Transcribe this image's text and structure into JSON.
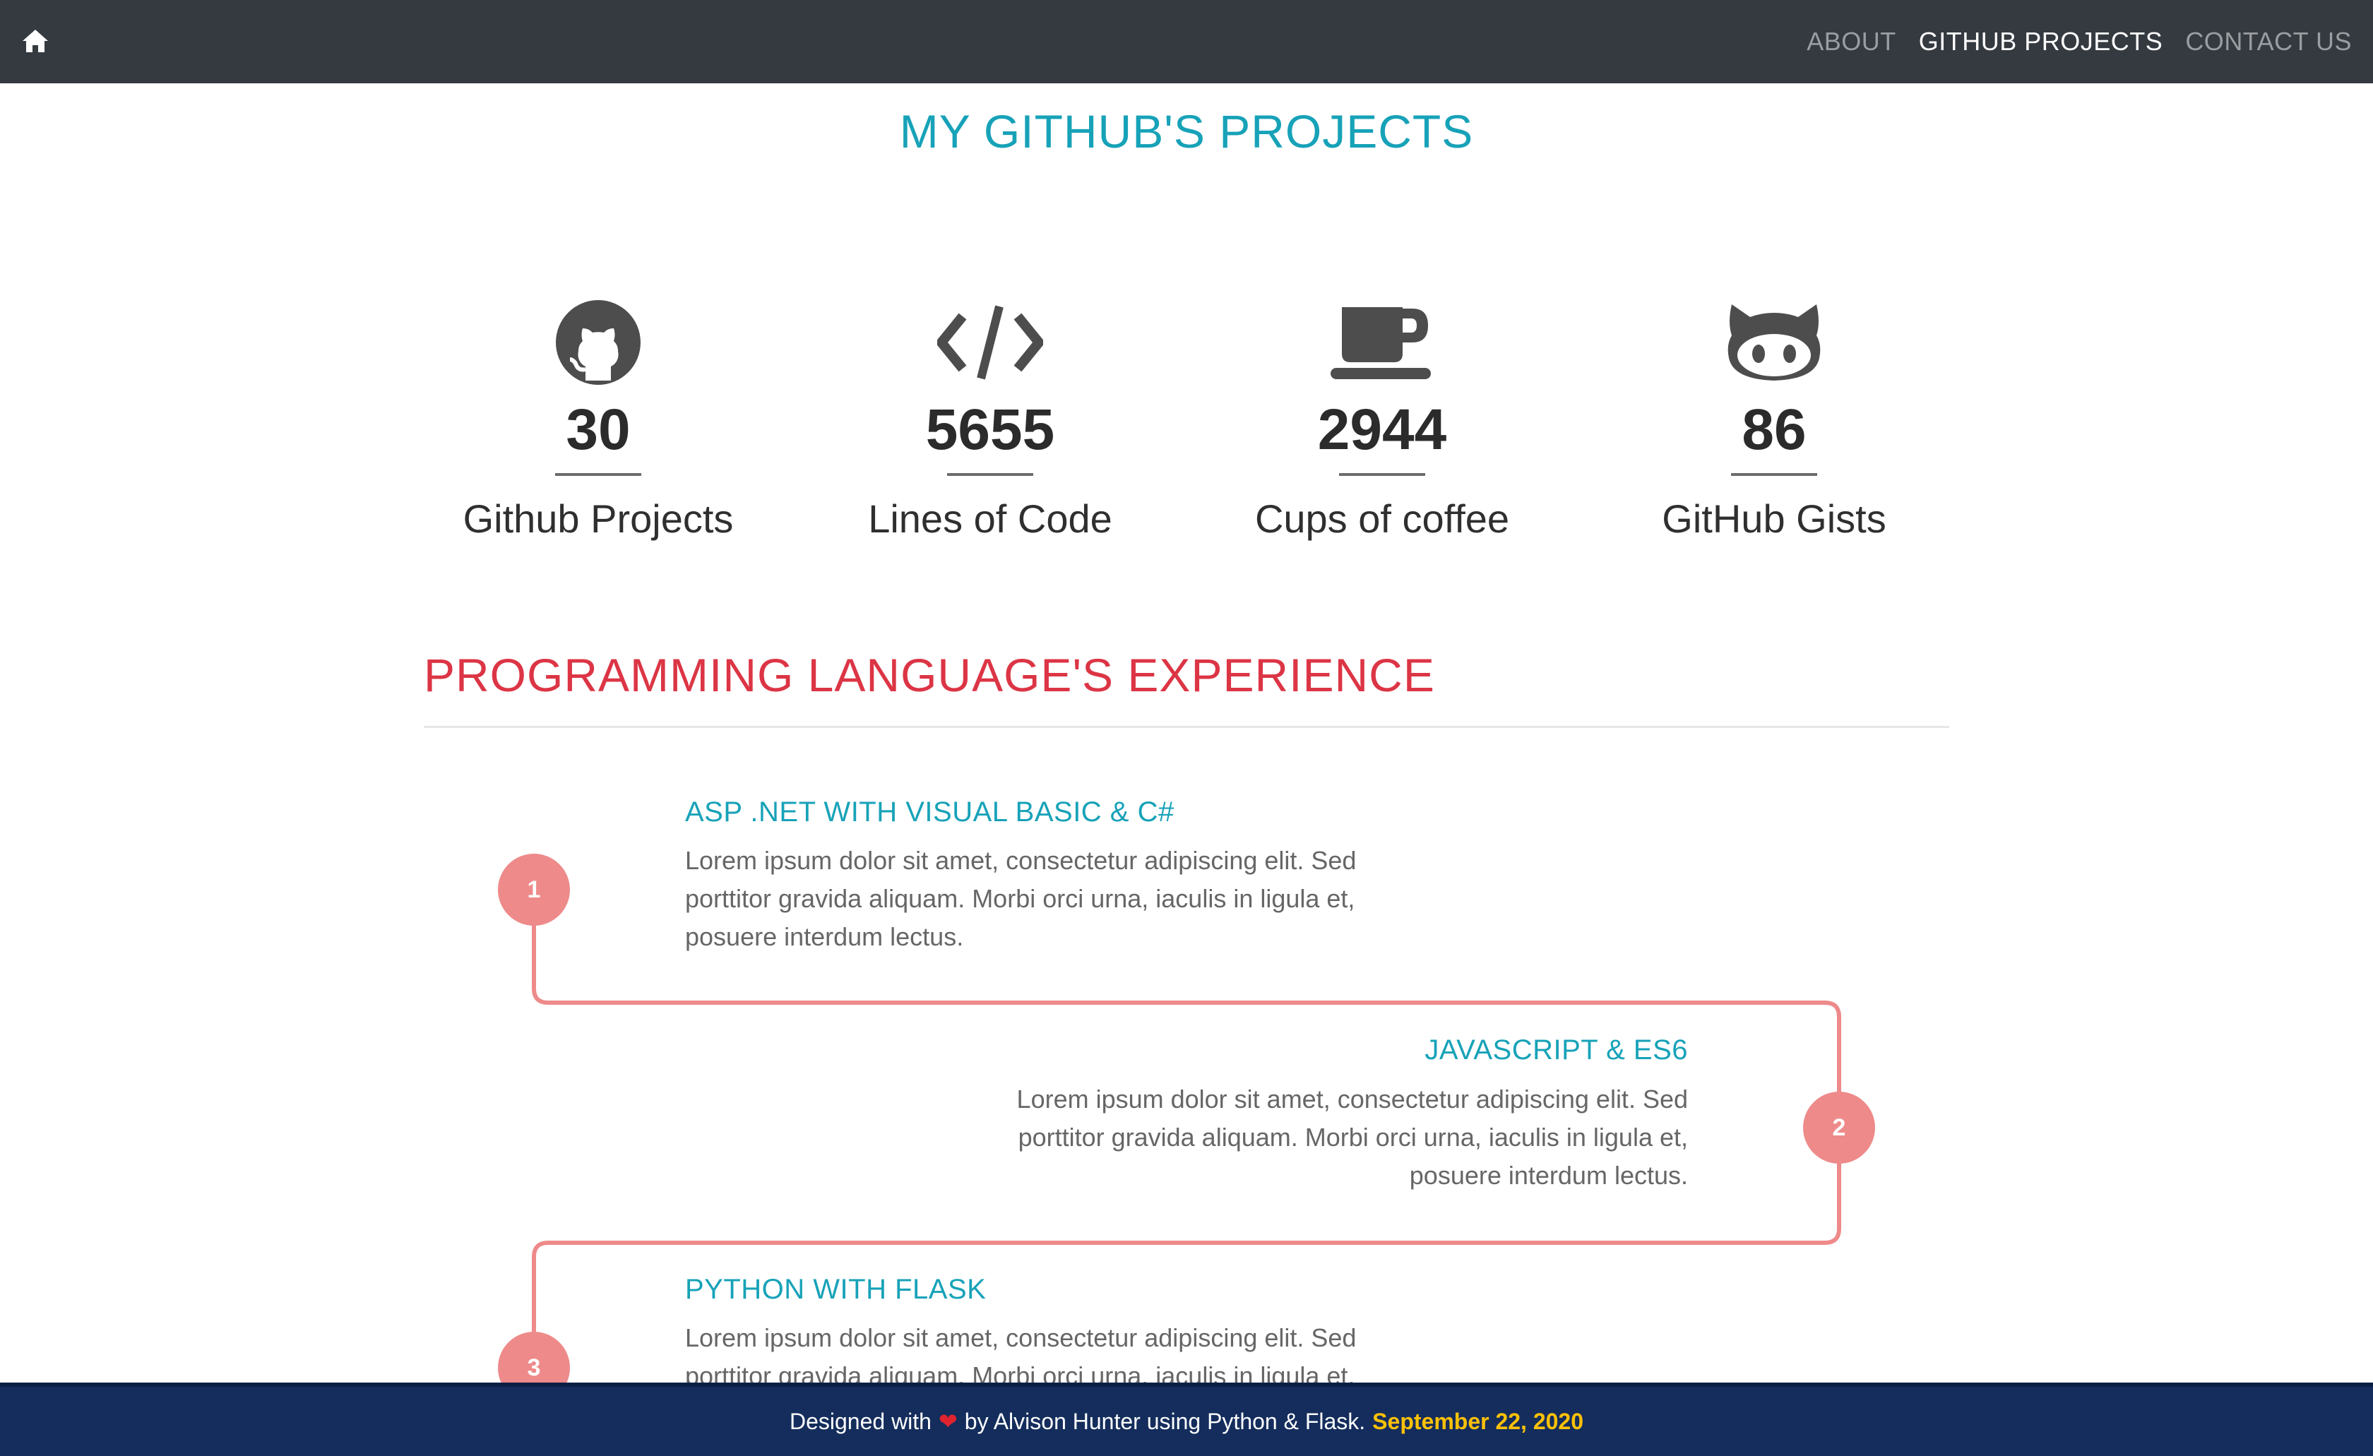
{
  "nav": {
    "home_icon": "home-icon",
    "links": [
      "ABOUT",
      "GITHUB PROJECTS",
      "CONTACT US"
    ],
    "active": "GITHUB PROJECTS"
  },
  "page_title": "MY GITHUB'S PROJECTS",
  "stats": [
    {
      "icon": "github-icon",
      "value": "30",
      "label": "Github Projects"
    },
    {
      "icon": "code-icon",
      "value": "5655",
      "label": "Lines of Code"
    },
    {
      "icon": "coffee-icon",
      "value": "2944",
      "label": "Cups of coffee"
    },
    {
      "icon": "github-alt-icon",
      "value": "86",
      "label": "GitHub Gists"
    }
  ],
  "section_title": "PROGRAMMING LANGUAGE'S EXPERIENCE",
  "timeline": [
    {
      "number": "1",
      "heading": "ASP .NET WITH VISUAL BASIC & C#",
      "text": "Lorem ipsum dolor sit amet, consectetur adipiscing elit. Sed porttitor gravida aliquam. Morbi orci urna, iaculis in ligula et, posuere interdum lectus."
    },
    {
      "number": "2",
      "heading": "JAVASCRIPT & ES6",
      "text": "Lorem ipsum dolor sit amet, consectetur adipiscing elit. Sed porttitor gravida aliquam. Morbi orci urna, iaculis in ligula et, posuere interdum lectus."
    },
    {
      "number": "3",
      "heading": "PYTHON WITH FLASK",
      "text": "Lorem ipsum dolor sit amet, consectetur adipiscing elit. Sed porttitor gravida aliquam. Morbi orci urna, iaculis in ligula et,"
    }
  ],
  "footer": {
    "before_heart": "Designed with",
    "heart": "❤",
    "after_heart": "by Alvison Hunter using Python & Flask.",
    "date": "September 22, 2020"
  },
  "colors": {
    "navbar": "#343a40",
    "accent_teal": "#17a2b8",
    "accent_red": "#dc3545",
    "timeline": "#ee8a8a",
    "footer": "#142d5c",
    "date": "#ffc107"
  }
}
